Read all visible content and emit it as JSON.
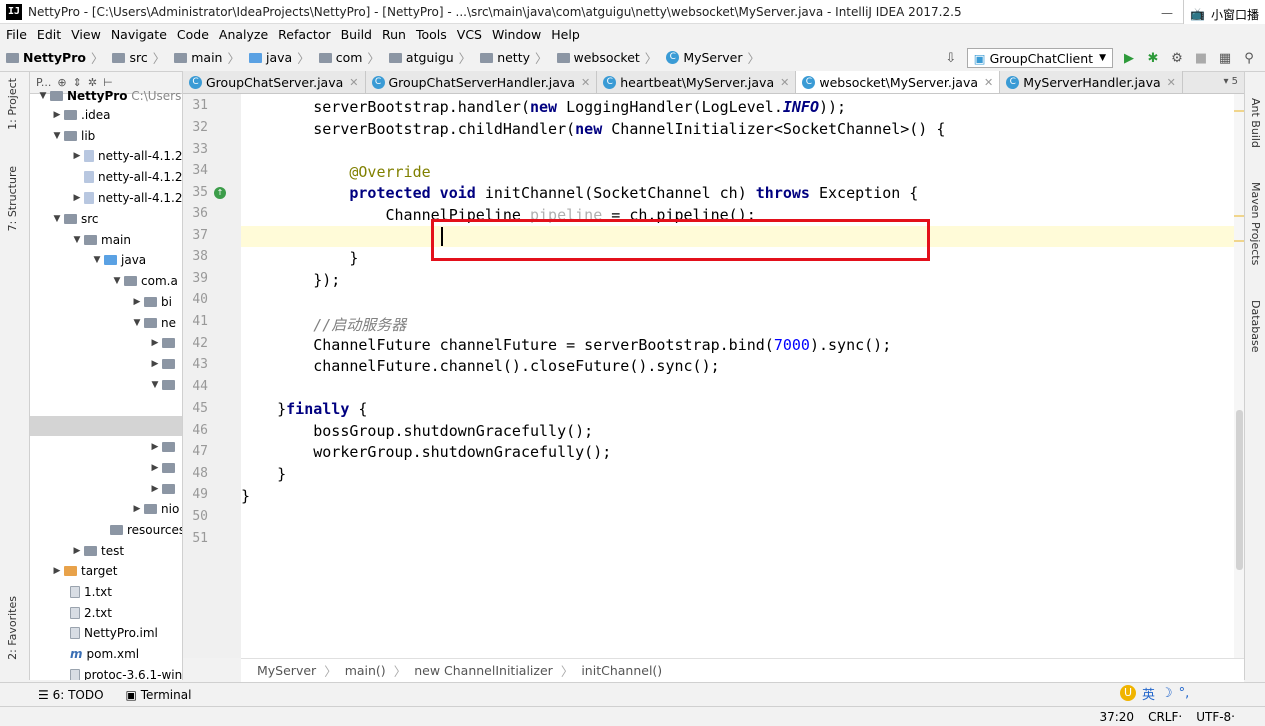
{
  "window": {
    "title": "NettyPro - [C:\\Users\\Administrator\\IdeaProjects\\NettyPro] - [NettyPro] - ...\\src\\main\\java\\com\\atguigu\\netty\\websocket\\MyServer.java - IntelliJ IDEA 2017.2.5",
    "app_icon": "IJ",
    "side_text": "小窗口播"
  },
  "menu": [
    "File",
    "Edit",
    "View",
    "Navigate",
    "Code",
    "Analyze",
    "Refactor",
    "Build",
    "Run",
    "Tools",
    "VCS",
    "Window",
    "Help"
  ],
  "navbar": {
    "crumbs": [
      "NettyPro",
      "src",
      "main",
      "java",
      "com",
      "atguigu",
      "netty",
      "websocket",
      "MyServer"
    ],
    "run_config": "GroupChatClient"
  },
  "left_tabs": {
    "project": "1: Project",
    "structure": "7: Structure",
    "favorites": "2: Favorites"
  },
  "right_tabs": {
    "ant": "Ant Build",
    "maven": "Maven Projects",
    "database": "Database"
  },
  "project_toolbar": "P...",
  "tree": [
    {
      "label": "NettyPro",
      "extra": "C:\\Users"
    },
    {
      "label": ".idea"
    },
    {
      "label": "lib"
    },
    {
      "label": "netty-all-4.1.2"
    },
    {
      "label": "netty-all-4.1.2"
    },
    {
      "label": "netty-all-4.1.2"
    },
    {
      "label": "src"
    },
    {
      "label": "main"
    },
    {
      "label": "java"
    },
    {
      "label": "com.a"
    },
    {
      "label": "bi"
    },
    {
      "label": "ne"
    },
    {
      "label": "resources"
    },
    {
      "label": "test"
    },
    {
      "label": "target"
    },
    {
      "label": "1.txt"
    },
    {
      "label": "2.txt"
    },
    {
      "label": "NettyPro.iml"
    },
    {
      "label": "pom.xml"
    },
    {
      "label": "protoc-3.6.1-win"
    }
  ],
  "tabs": [
    {
      "label": "GroupChatServer.java",
      "active": false
    },
    {
      "label": "GroupChatServerHandler.java",
      "active": false
    },
    {
      "label": "heartbeat\\MyServer.java",
      "active": false
    },
    {
      "label": "websocket\\MyServer.java",
      "active": true
    },
    {
      "label": "MyServerHandler.java",
      "active": false
    }
  ],
  "tabs_more": "▾ 5",
  "code": {
    "line_numbers": [
      "31",
      "32",
      "33",
      "34",
      "35",
      "36",
      "37",
      "38",
      "39",
      "40",
      "41",
      "42",
      "43",
      "44",
      "45",
      "46",
      "47",
      "48",
      "49",
      "50",
      "51"
    ],
    "l31a": "        serverBootstrap.handler(",
    "l31b": "new",
    "l31c": " LoggingHandler(LogLevel.",
    "l31d": "INFO",
    "l31e": "));",
    "l32a": "        serverBootstrap.childHandler(",
    "l32b": "new",
    "l32c": " ChannelInitializer<SocketChannel>() {",
    "l34": "            @Override",
    "l35a": "            ",
    "l35b": "protected void",
    "l35c": " initChannel(SocketChannel ch) ",
    "l35d": "throws",
    "l35e": " Exception {",
    "l36a": "                ChannelPipeline ",
    "l36b": "pipeline",
    "l36c": " = ch.pipeline();",
    "l38": "            }",
    "l39": "        });",
    "l41": "        //启动服务器",
    "l42a": "        ChannelFuture channelFuture = serverBootstrap.bind(",
    "l42b": "7000",
    "l42c": ").sync();",
    "l43": "        channelFuture.channel().closeFuture().sync();",
    "l45a": "    }",
    "l45b": "finally",
    "l45c": " {",
    "l46": "        bossGroup.shutdownGracefully();",
    "l47": "        workerGroup.shutdownGracefully();",
    "l48": "    }",
    "l49": "}",
    "l50": "}"
  },
  "breadcrumb": [
    "MyServer",
    "main()",
    "new ChannelInitializer",
    "initChannel()"
  ],
  "bottom_tools": {
    "todo": "6: TODO",
    "terminal": "Terminal"
  },
  "status": {
    "position": "37:20",
    "line_sep": "CRLF‧",
    "encoding": "UTF-8‧"
  },
  "ime": {
    "label": "英"
  },
  "colors": {
    "highlight_box": "#e3101b",
    "caret_line": "#fffbd8",
    "keyword": "#000080",
    "annotation": "#808000",
    "number": "#0000ff"
  }
}
